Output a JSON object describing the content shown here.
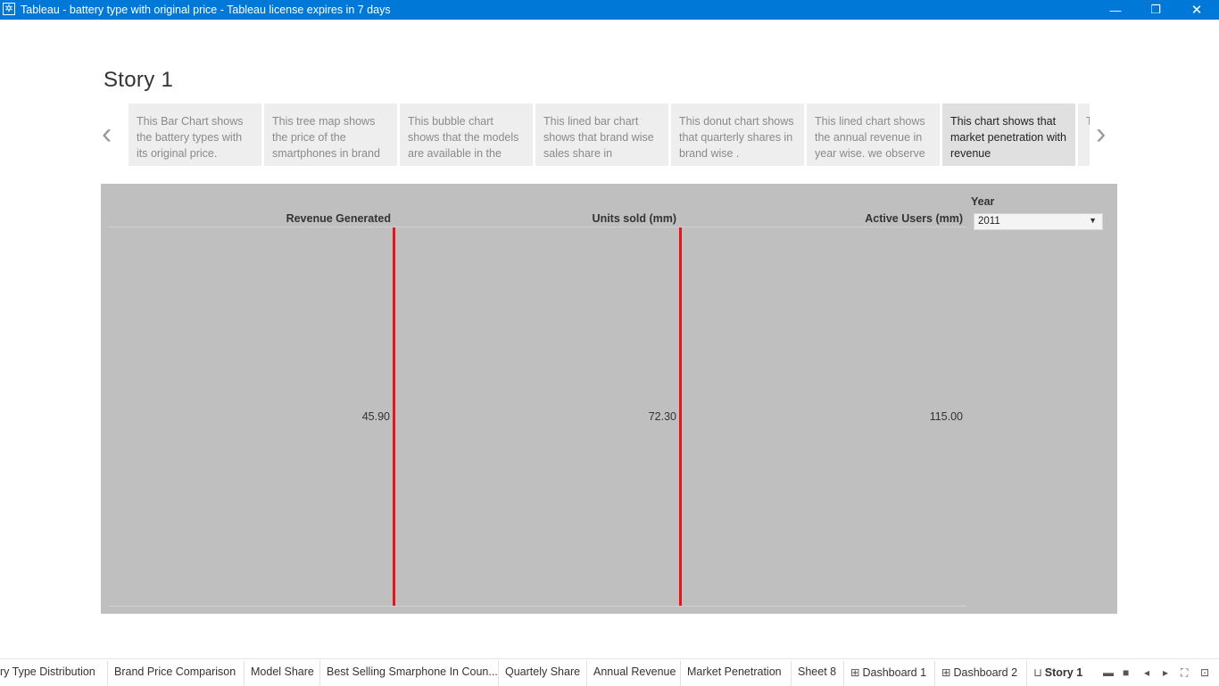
{
  "window": {
    "title": "Tableau - battery type with original price - Tableau license expires in 7 days",
    "app_icon": "tableau-icon",
    "controls": {
      "minimize": "—",
      "restore": "❐",
      "close": "✕"
    }
  },
  "story": {
    "title": "Story 1",
    "prev_arrow": "‹",
    "next_arrow": "›",
    "points": [
      "This Bar Chart  shows the battery types with its  original price.",
      "This tree map shows the price of the smartphones in brand",
      "This bubble chart shows that the models are available in the",
      "This lined bar chart shows that brand wise sales share in",
      "This donut chart shows that quarterly shares in brand wise .",
      "This lined  chart shows the annual revenue in year wise. we observe",
      "This chart shows that market penetration with revenue",
      "T p i"
    ],
    "active_point": 6
  },
  "dashboard": {
    "columns": [
      {
        "header": "Revenue Generated",
        "value": "45.90"
      },
      {
        "header": "Units sold (mm)",
        "value": "72.30"
      },
      {
        "header": "Active Users (mm)",
        "value": "115.00"
      }
    ],
    "filter": {
      "label": "Year",
      "value": "2011"
    },
    "colors": {
      "background": "#bfbfbf",
      "reference_line": "#e8141b"
    }
  },
  "tabs": [
    {
      "label": "ry Type Distribution",
      "icon": ""
    },
    {
      "label": "Brand Price Comparison",
      "icon": ""
    },
    {
      "label": "Model Share",
      "icon": ""
    },
    {
      "label": "Best Selling Smarphone In Coun...",
      "icon": ""
    },
    {
      "label": "Quartely Share",
      "icon": ""
    },
    {
      "label": "Annual Revenue",
      "icon": ""
    },
    {
      "label": "Market Penetration",
      "icon": ""
    },
    {
      "label": "Sheet 8",
      "icon": ""
    },
    {
      "label": "Dashboard 1",
      "icon": "dashboard-icon"
    },
    {
      "label": "Dashboard 2",
      "icon": "dashboard-icon"
    },
    {
      "label": "Story 1",
      "icon": "story-icon"
    }
  ],
  "active_tab": "Story 1"
}
